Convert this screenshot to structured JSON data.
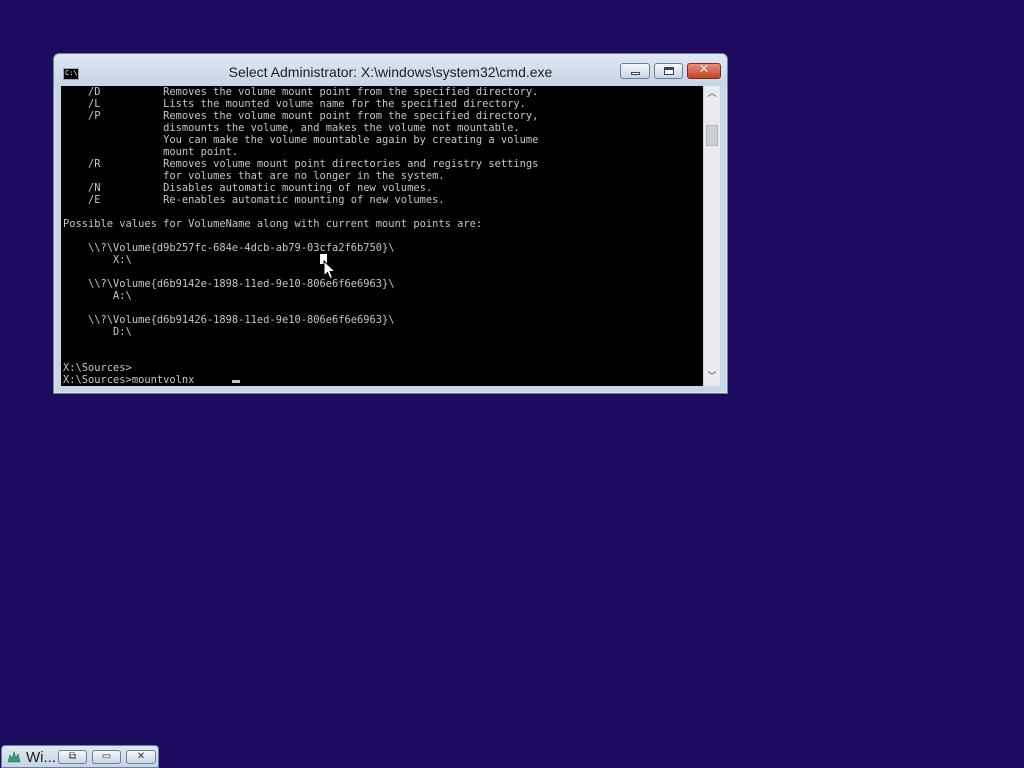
{
  "window": {
    "title": "Select Administrator: X:\\windows\\system32\\cmd.exe",
    "icon": "cmd-icon",
    "icon_text": "C:\\."
  },
  "controls": {
    "minimize": "minimize-icon",
    "maximize": "maximize-icon",
    "close_glyph": "✕"
  },
  "console": {
    "text": "    /D          Removes the volume mount point from the specified directory.\n    /L          Lists the mounted volume name for the specified directory.\n    /P          Removes the volume mount point from the specified directory,\n                dismounts the volume, and makes the volume not mountable.\n                You can make the volume mountable again by creating a volume\n                mount point.\n    /R          Removes volume mount point directories and registry settings\n                for volumes that are no longer in the system.\n    /N          Disables automatic mounting of new volumes.\n    /E          Re-enables automatic mounting of new volumes.\n\nPossible values for VolumeName along with current mount points are:\n\n    \\\\?\\Volume{d9b257fc-684e-4dcb-ab79-03cfa2f6b750}\\\n        X:\\\n\n    \\\\?\\Volume{d6b9142e-1898-11ed-9e10-806e6f6e6963}\\\n        A:\\\n\n    \\\\?\\Volume{d6b91426-1898-11ed-9e10-806e6f6e6963}\\\n        D:\\\n\n\nX:\\Sources>\nX:\\Sources>mountvolnx",
    "text_color": "#c6c6c6",
    "background": "#000000"
  },
  "scrollbar": {
    "up_arrow": "︿",
    "down_arrow": "﹀"
  },
  "taskbar": {
    "label": "Wi...",
    "icon": "windows-setup-icon",
    "restore_glyph": "⧉",
    "max_glyph": "▭",
    "close_glyph": "✕"
  },
  "desktop": {
    "background": "#1c0b5e"
  }
}
